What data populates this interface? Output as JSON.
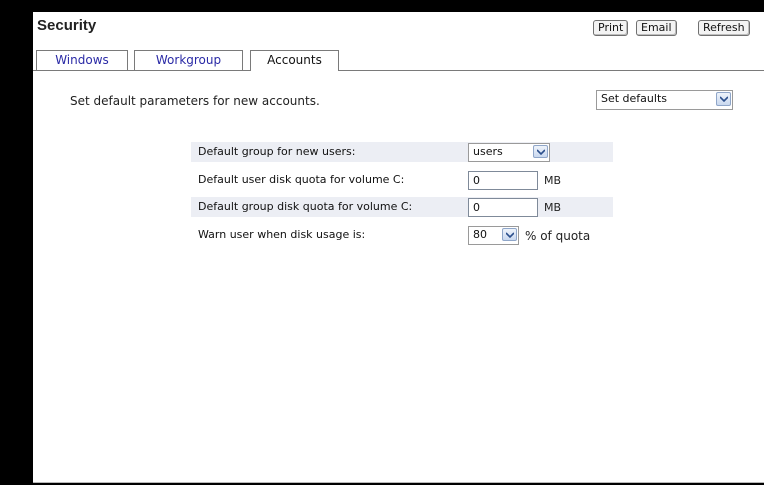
{
  "header": {
    "title": "Security",
    "buttons": {
      "print": "Print",
      "email": "Email",
      "refresh": "Refresh"
    }
  },
  "tabs": [
    {
      "label": "Windows",
      "active": false
    },
    {
      "label": "Workgroup",
      "active": false
    },
    {
      "label": "Accounts",
      "active": true
    }
  ],
  "intro_text": "Set default parameters for new accounts.",
  "defaults_select": {
    "value": "Set defaults"
  },
  "form": {
    "default_group": {
      "label": "Default group for new users:",
      "value": "users"
    },
    "user_quota": {
      "label": "Default user disk quota for volume C:",
      "value": "0",
      "unit": "MB"
    },
    "group_quota": {
      "label": "Default group disk quota for volume C:",
      "value": "0",
      "unit": "MB"
    },
    "warn": {
      "label": "Warn user when disk usage is:",
      "value": "80",
      "unit": "% of quota"
    }
  },
  "icons": {
    "dropdown": "chevron-down-icon"
  },
  "colors": {
    "tab_link": "#2a2aa6",
    "row_shade": "#eceef4",
    "frame": "#000000"
  }
}
